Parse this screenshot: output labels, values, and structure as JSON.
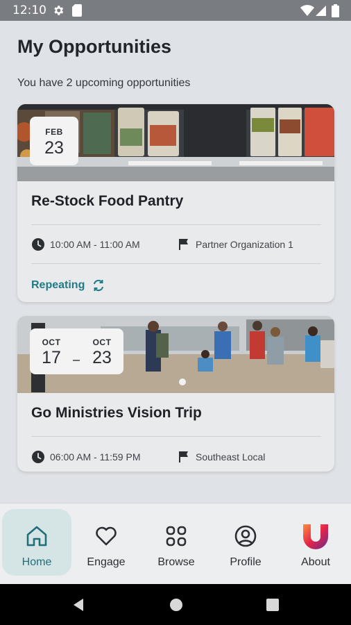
{
  "status_bar": {
    "time": "12:10"
  },
  "page": {
    "title": "My Opportunities",
    "subtitle": "You have 2 upcoming opportunities"
  },
  "opportunities": [
    {
      "date_month": "FEB",
      "date_day": "23",
      "title": "Re-Stock Food Pantry",
      "time": "10:00 AM - 11:00 AM",
      "organization": "Partner Organization 1",
      "repeating_label": "Repeating"
    },
    {
      "start_month": "OCT",
      "start_day": "17",
      "end_month": "OCT",
      "end_day": "23",
      "title": "Go Ministries Vision Trip",
      "time": "06:00 AM - 11:59 PM",
      "organization": "Southeast Local"
    }
  ],
  "bottom_nav": [
    {
      "label": "Home",
      "icon": "home-icon",
      "active": true
    },
    {
      "label": "Engage",
      "icon": "heart-icon"
    },
    {
      "label": "Browse",
      "icon": "grid-icon"
    },
    {
      "label": "Profile",
      "icon": "profile-icon"
    },
    {
      "label": "About",
      "icon": "app-logo-icon"
    }
  ],
  "colors": {
    "accent": "#1f7b87",
    "active_nav_bg": "#d5e5e6",
    "background": "#dfe2e6",
    "status_bar": "#797c80"
  }
}
